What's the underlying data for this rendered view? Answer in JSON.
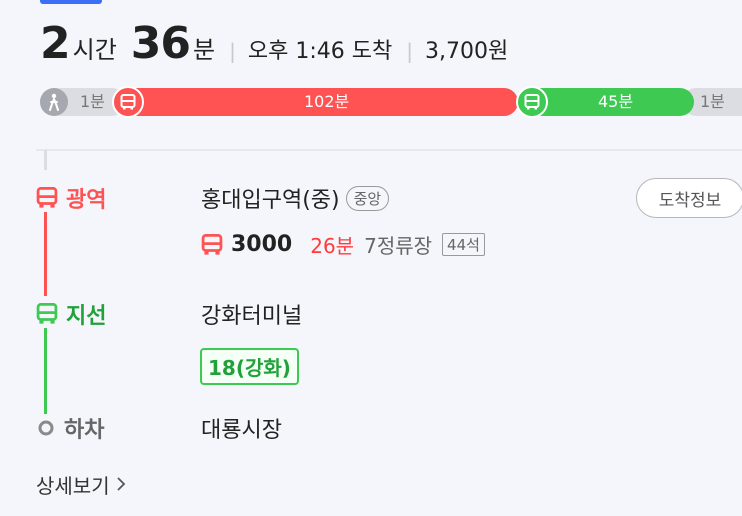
{
  "summary": {
    "hours": "2",
    "hours_unit": "시간",
    "minutes": "36",
    "minutes_unit": "분",
    "arrival": "오후 1:46 도착",
    "fare": "3,700원",
    "separator": "|"
  },
  "segments": [
    {
      "type": "walk",
      "label": "1분"
    },
    {
      "type": "bus",
      "label": "102분",
      "color": "#ff5353"
    },
    {
      "type": "bus",
      "label": "45분",
      "color": "#3ec953"
    },
    {
      "type": "walk",
      "label": "1분"
    }
  ],
  "steps": {
    "board": {
      "label": "광역",
      "color": "#ff5353",
      "stop": "홍대입구역(중)",
      "direction": "중앙",
      "arrival_button": "도착정보",
      "route": {
        "number": "3000",
        "minutes": "26분",
        "stops": "7정류장",
        "seats": "44석"
      }
    },
    "transfer": {
      "label": "지선",
      "color": "#3ec953",
      "stop": "강화터미널",
      "route_badge": "18(강화)"
    },
    "alight": {
      "label": "하차",
      "stop": "대룡시장"
    }
  },
  "detail_link": "상세보기",
  "icons": {
    "walk": "walking-person-icon",
    "bus": "bus-icon",
    "alight": "ring-dot-icon",
    "chevron": "chevron-right-icon"
  }
}
